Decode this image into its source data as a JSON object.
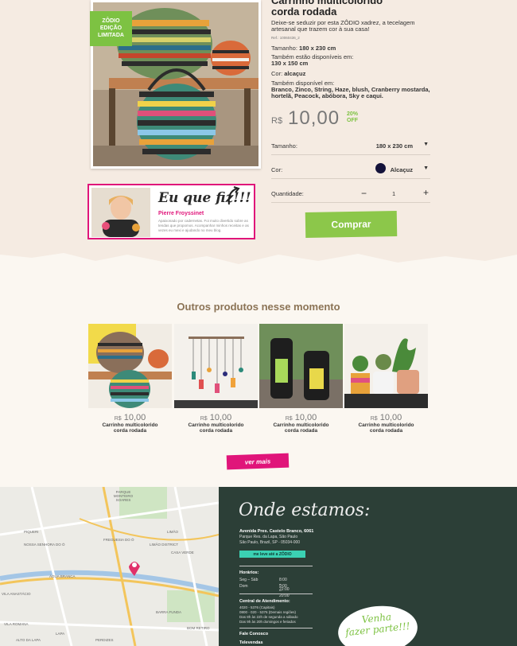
{
  "product": {
    "badge": [
      "ZÔDIO",
      "EDIÇÃO",
      "LIMITADA"
    ],
    "title_line1": "Carrinho multicolorido",
    "title_line2": "corda rodada",
    "description": "Deixe-se seduzir por esta ZÔDIO xadrez, a tecelagem artesanal que trazem cor à sua casa!",
    "ref": "Ref.: 10060436_2",
    "size_label": "Tamanho:",
    "size_value": "180 x 230 cm",
    "also_sizes_label": "Também estão disponíveis em:",
    "also_sizes_value": "130 x 150 cm",
    "color_label": "Cor:",
    "color_value": "alcaçuz",
    "also_colors_label": "Também disponível em:",
    "also_colors_value": "Branco, Zinco, String, Haze, blush, Cranberry mostarda, hortelã, Peacock, abóbora, Sky e caqui.",
    "currency": "R$",
    "price": "10,00",
    "discount": "20%",
    "discount_suffix": "OFF",
    "sel_size_label": "Tamanho:",
    "sel_size_value": "180 x 230 cm",
    "sel_color_label": "Cor:",
    "sel_color_value": "Alcaçuz",
    "qty_label": "Quantidade:",
    "qty_value": "1",
    "qty_minus": "−",
    "qty_plus": "+",
    "buy_label": "Comprar",
    "swatch_color": "#14123a",
    "accent_green": "#7dc242",
    "accent_pink": "#e0157a"
  },
  "testimonial": {
    "title": "Eu que fiz!!!",
    "name": "Pierre Froyssinet",
    "text": "Apaixonado por cadernetas. Foi muito divertido sobre as tendas que propomos. Acompanhar minhos receitas e as vezes eu mexi e ajudando no meu blog."
  },
  "others": {
    "title": "Outros produtos nesse momento",
    "items": [
      {
        "currency": "R$",
        "price": "10,00",
        "name_line1": "Carrinho multicolorido",
        "name_line2": "corda rodada"
      },
      {
        "currency": "R$",
        "price": "10,00",
        "name_line1": "Carrinho multicolorido",
        "name_line2": "corda rodada"
      },
      {
        "currency": "R$",
        "price": "10,00",
        "name_line1": "Carrinho multicolorido",
        "name_line2": "corda rodada"
      },
      {
        "currency": "R$",
        "price": "10,00",
        "name_line1": "Carrinho multicolorido",
        "name_line2": "corda rodada"
      }
    ],
    "more_label": "ver mais"
  },
  "store": {
    "heading": "Onde estamos:",
    "address_line1": "Avenida Pres. Castelo Branco, 6061",
    "address_line2": "Parque Res. da Lapa, São Paulo",
    "address_line3": "São Paulo, Brazil, SP - 05034-000",
    "go_button": "me leve até a ZÔDIO",
    "hours_title": "Horários:",
    "hours": [
      {
        "days": "Seg – Sáb",
        "time": "8:00 – 22:00"
      },
      {
        "days": "Dom",
        "time": "9:00 – 20:00"
      }
    ],
    "service_title": "Central de Atendimento:",
    "service_line1": "4020 - 5376 (Capitais)",
    "service_line2": "0800 - 020 - 5376 (Demais regiões)",
    "service_line3": "Das 8h às 22h de segunda a sábado",
    "service_line4": "Das 9h às 20h domingos e feriados",
    "contact_link": "Fale Conosco",
    "sales_label": "Televendas",
    "join_line1": "Venha",
    "join_line2": "fazer parte!!!"
  },
  "map": {
    "labels": [
      "PARQUE MONTEIRO SOARES",
      "PIQUERI",
      "NOSSA SENHORA DO Ó",
      "LIMÃO",
      "FREGUESIA DO Ó",
      "CASA VERDE",
      "BARRA FUNDA",
      "ÁGUA BRANCA",
      "LAPA",
      "VILA ANASTÁCIO",
      "ALTO DA LAPA",
      "LIMÃO DISTRICT",
      "VILA ROMANA",
      "BOM RETIRO",
      "PERDIZES"
    ]
  }
}
